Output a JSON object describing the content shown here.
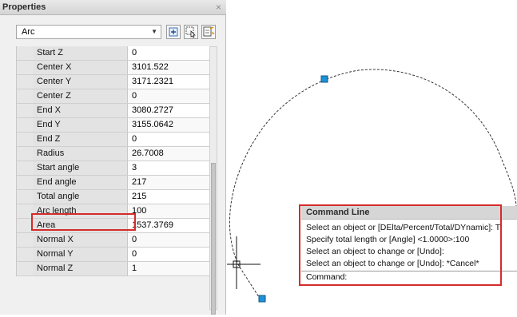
{
  "palette": {
    "title": "Properties",
    "close_glyph": "×",
    "object_type": "Arc",
    "dropdown_icon": "chevron-down-icon",
    "toolbar_icons": [
      "toggle-pickadd-icon",
      "select-objects-icon",
      "quick-select-icon"
    ]
  },
  "properties": [
    {
      "label": "Start Z",
      "value": "0"
    },
    {
      "label": "Center X",
      "value": "3101.522"
    },
    {
      "label": "Center Y",
      "value": "3171.2321"
    },
    {
      "label": "Center Z",
      "value": "0"
    },
    {
      "label": "End X",
      "value": "3080.2727"
    },
    {
      "label": "End Y",
      "value": "3155.0642"
    },
    {
      "label": "End Z",
      "value": "0"
    },
    {
      "label": "Radius",
      "value": "26.7008"
    },
    {
      "label": "Start angle",
      "value": "3"
    },
    {
      "label": "End angle",
      "value": "217"
    },
    {
      "label": "Total angle",
      "value": "215"
    },
    {
      "label": "Arc length",
      "value": "100"
    },
    {
      "label": "Area",
      "value": "1537.3769"
    },
    {
      "label": "Normal X",
      "value": "0"
    },
    {
      "label": "Normal Y",
      "value": "0"
    },
    {
      "label": "Normal Z",
      "value": "1"
    }
  ],
  "highlighted_property": "Arc length",
  "command_line": {
    "title": "Command Line",
    "history": [
      "Select an object or [DElta/Percent/Total/DYnamic]: T",
      "Specify total length or [Angle] <1.0000>:100",
      "Select an object to change or [Undo]:",
      "Select an object to change or [Undo]: *Cancel*"
    ],
    "prompt": "Command:"
  },
  "colors": {
    "highlight": "#d52b2b",
    "grip": "#1e90d6",
    "arc": "#333333"
  }
}
